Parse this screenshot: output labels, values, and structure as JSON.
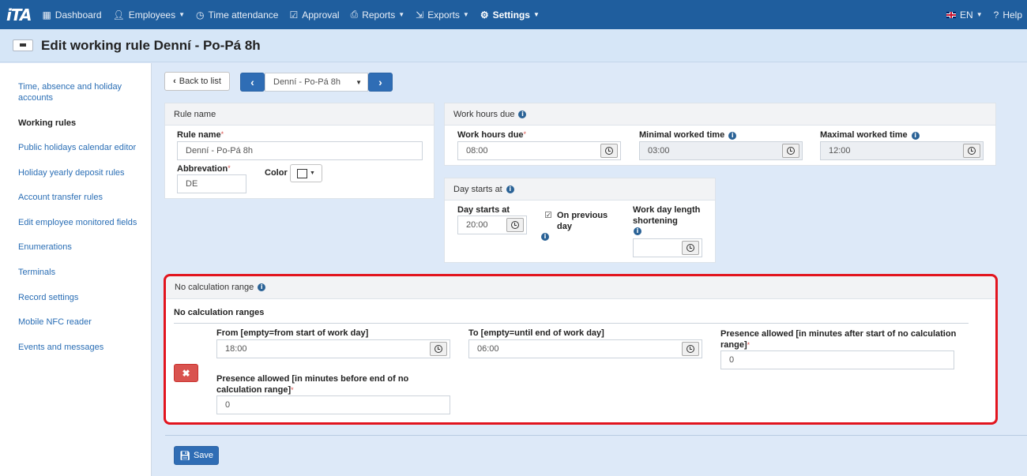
{
  "nav": {
    "logo": "iTA",
    "items": [
      {
        "label": "Dashboard",
        "icon": "dashboard-icon",
        "caret": false
      },
      {
        "label": "Employees",
        "icon": "user-icon",
        "caret": true
      },
      {
        "label": "Time attendance",
        "icon": "clock-icon",
        "caret": false
      },
      {
        "label": "Approval",
        "icon": "check-icon",
        "caret": false
      },
      {
        "label": "Reports",
        "icon": "print-icon",
        "caret": true
      },
      {
        "label": "Exports",
        "icon": "export-icon",
        "caret": true
      },
      {
        "label": "Settings",
        "icon": "gear-icon",
        "caret": true
      }
    ],
    "language": "EN",
    "help": "Help"
  },
  "page_title": "Edit working rule Denní - Po-Pá 8h",
  "sidebar": {
    "items": [
      "Time, absence and holiday accounts",
      "Working rules",
      "Public holidays calendar editor",
      "Holiday yearly deposit rules",
      "Account transfer rules",
      "Edit employee monitored fields",
      "Enumerations",
      "Terminals",
      "Record settings",
      "Mobile NFC reader",
      "Events and messages"
    ],
    "active": "Working rules"
  },
  "toolbar": {
    "back_label": "Back to list",
    "rule_select": "Denní - Po-Pá 8h"
  },
  "rule_panel": {
    "title": "Rule name",
    "rule_name_label": "Rule name",
    "rule_name_value": "Denní - Po-Pá 8h",
    "abbrev_label": "Abbrevation",
    "abbrev_value": "DE",
    "color_label": "Color"
  },
  "work_hours_panel": {
    "title": "Work hours due",
    "due_label": "Work hours due",
    "due_value": "08:00",
    "min_label": "Minimal worked time",
    "min_value": "03:00",
    "max_label": "Maximal worked time",
    "max_value": "12:00"
  },
  "day_start_panel": {
    "title": "Day starts at",
    "start_label": "Day starts at",
    "start_value": "20:00",
    "prev_day_label": "On previous day",
    "prev_day_checked": true,
    "shortening_label": "Work day length shortening",
    "shortening_value": ""
  },
  "no_calc_panel": {
    "title": "No calculation range",
    "subtitle": "No calculation ranges",
    "from_label": "From [empty=from start of work day]",
    "from_value": "18:00",
    "to_label": "To [empty=until end of work day]",
    "to_value": "06:00",
    "presence_after_label": "Presence allowed [in minutes after start of no calculation range]",
    "presence_after_value": "0",
    "presence_before_label": "Presence allowed [in minutes before end of no calculation range]",
    "presence_before_value": "0"
  },
  "save_label": "Save",
  "colors": {
    "navbar": "#1f5e9e",
    "highlight": "#e2141e",
    "link": "#2a6eb5"
  }
}
